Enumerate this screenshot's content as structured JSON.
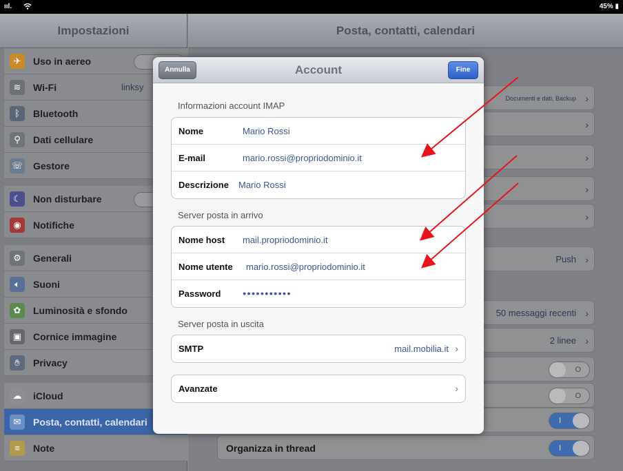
{
  "statusbar": {
    "battery": "45%"
  },
  "sidebar": {
    "title": "Impostazioni",
    "items": [
      {
        "label": "Uso in aereo"
      },
      {
        "label": "Wi-Fi",
        "value": "linksy"
      },
      {
        "label": "Bluetooth"
      },
      {
        "label": "Dati cellulare"
      },
      {
        "label": "Gestore"
      },
      {
        "label": "Non disturbare"
      },
      {
        "label": "Notifiche"
      },
      {
        "label": "Generali"
      },
      {
        "label": "Suoni"
      },
      {
        "label": "Luminosità e sfondo"
      },
      {
        "label": "Cornice immagine"
      },
      {
        "label": "Privacy"
      },
      {
        "label": "iCloud"
      },
      {
        "label": "Posta, contatti, calendari"
      },
      {
        "label": "Note"
      }
    ]
  },
  "detail": {
    "title": "Posta, contatti, calendari",
    "rows": [
      {
        "value": "Documenti e dati, Backup"
      },
      {
        "value": "Push"
      },
      {
        "value": "50 messaggi recenti"
      },
      {
        "value": "2 linee"
      },
      {
        "label": "Organizza in thread"
      }
    ]
  },
  "modal": {
    "title": "Account",
    "cancel_label": "Annulla",
    "done_label": "Fine",
    "imap_section": "Informazioni account IMAP",
    "imap": {
      "name_label": "Nome",
      "name_value": "Mario Rossi",
      "email_label": "E-mail",
      "email_value": "mario.rossi@propriodominio.it",
      "desc_label": "Descrizione",
      "desc_value": "Mario Rossi"
    },
    "incoming_section": "Server posta in arrivo",
    "incoming": {
      "host_label": "Nome host",
      "host_value": "mail.propriodominio.it",
      "user_label": "Nome utente",
      "user_value": "mario.rossi@propriodominio.it",
      "pass_label": "Password",
      "pass_value": "●●●●●●●●●●●"
    },
    "outgoing_section": "Server posta in uscita",
    "smtp_label": "SMTP",
    "smtp_value": "mail.mobilia.it",
    "advanced_label": "Avanzate"
  },
  "colors": {
    "arrow": "#e8141b",
    "accent": "#2e5fc9"
  }
}
